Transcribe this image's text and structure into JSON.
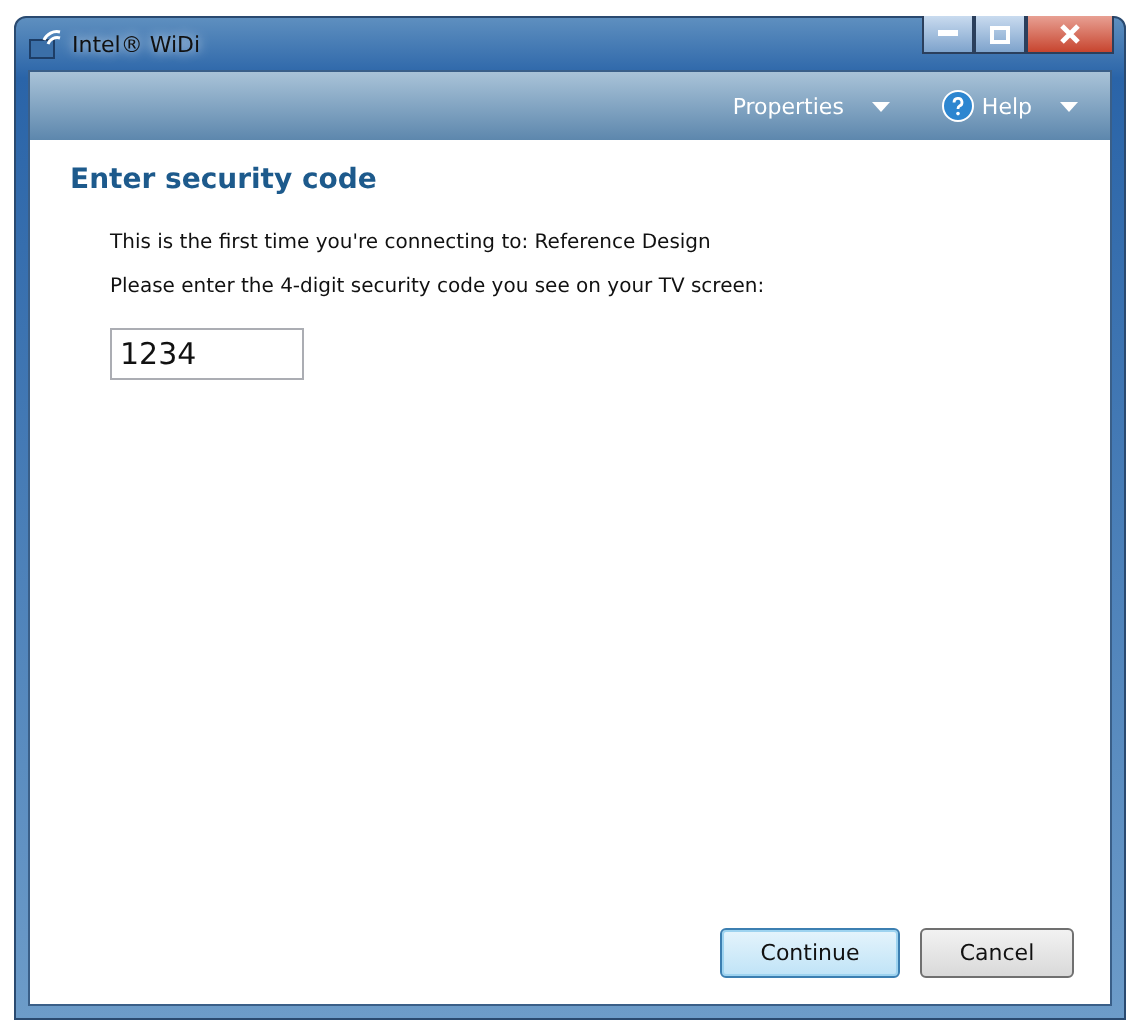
{
  "window": {
    "title": "Intel® WiDi"
  },
  "menu": [
    {
      "label": "Properties",
      "kind": "dropdown"
    },
    {
      "label": "Help",
      "kind": "help"
    }
  ],
  "heading": "Enter security code",
  "lines": [
    "This is the first time you're connecting to: Reference Design",
    "Please enter the 4-digit security code you see on your TV screen:"
  ],
  "code_field": {
    "value": "1234"
  },
  "buttons": [
    {
      "label": "Continue",
      "default": true
    },
    {
      "label": "Cancel",
      "default": false
    }
  ]
}
